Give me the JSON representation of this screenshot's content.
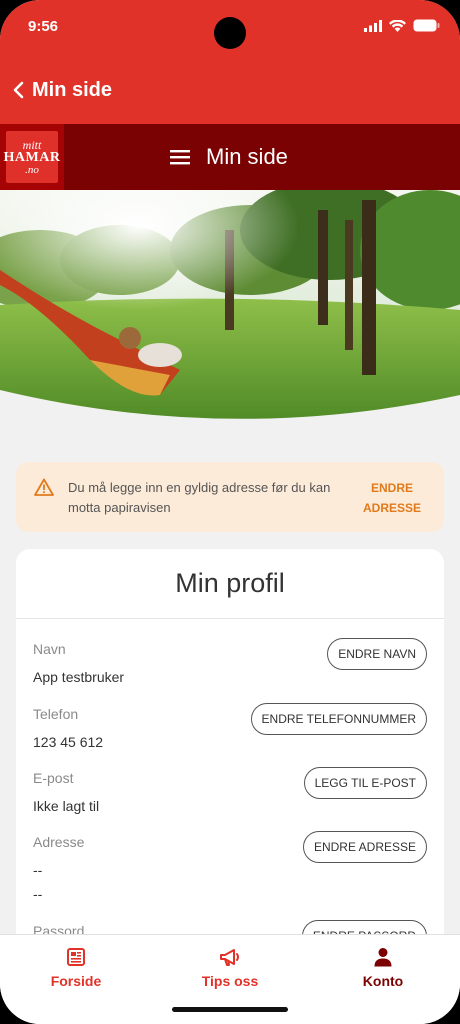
{
  "status_bar": {
    "time": "9:56"
  },
  "app_bar": {
    "back_label": "Min side"
  },
  "sub_header": {
    "title": "Min side",
    "logo": {
      "line1": "mitt",
      "line2": "HAMAR",
      "line3": ".no"
    }
  },
  "alert": {
    "message": "Du må legge inn en gyldig adresse før du kan motta papiravisen",
    "action_line1": "ENDRE",
    "action_line2": "ADRESSE"
  },
  "profile": {
    "title": "Min profil",
    "rows": [
      {
        "label": "Navn",
        "value": "App testbruker",
        "button": "ENDRE NAVN"
      },
      {
        "label": "Telefon",
        "value": "123 45 612",
        "button": "ENDRE TELEFONNUMMER"
      },
      {
        "label": "E-post",
        "value": "Ikke lagt til",
        "button": "LEGG TIL E-POST"
      },
      {
        "label": "Adresse",
        "value": "--",
        "value2": "--",
        "button": "ENDRE ADRESSE"
      },
      {
        "label": "Passord",
        "value": "",
        "button": "ENDRE PASSORD"
      }
    ]
  },
  "tabs": [
    {
      "label": "Forside",
      "icon": "newspaper-icon"
    },
    {
      "label": "Tips oss",
      "icon": "megaphone-icon"
    },
    {
      "label": "Konto",
      "icon": "user-icon"
    }
  ],
  "colors": {
    "brand_red": "#e13229",
    "dark_red": "#7b0202",
    "alert_bg": "#fdebd9",
    "alert_accent": "#e07a1a"
  }
}
